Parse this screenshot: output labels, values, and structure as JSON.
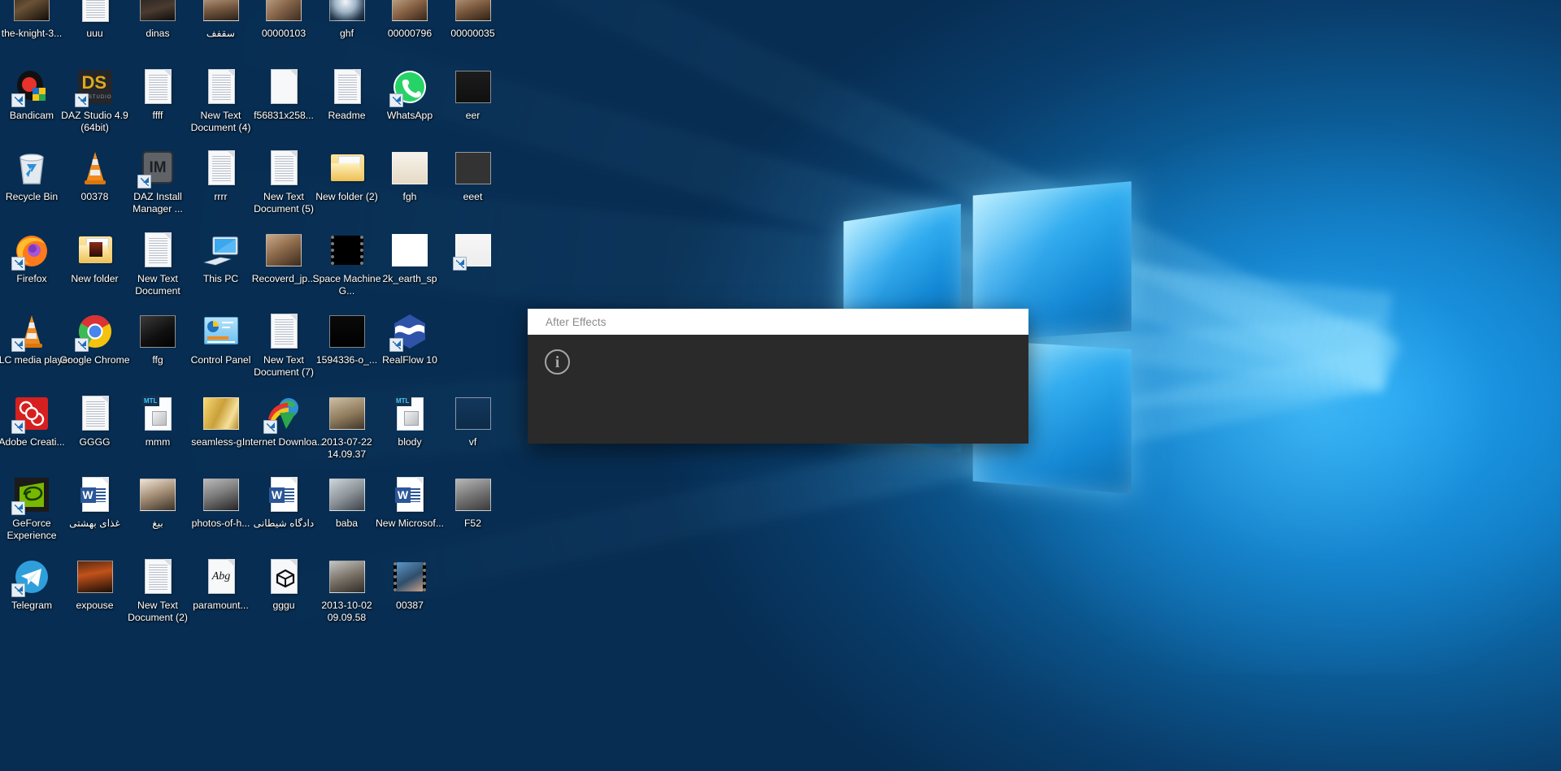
{
  "desktop": {
    "wallpaper_name": "windows-10-hero-blue",
    "colors": {
      "wallpaper_dark": "#0a2742",
      "wallpaper_accent": "#1a9ff0",
      "label_text": "#ffffff"
    },
    "icons": [
      {
        "label": "the-knight-3...",
        "art": "thumb",
        "thumb": "dark-figure",
        "shortcut": false,
        "col": 0,
        "row": 0
      },
      {
        "label": "uuu",
        "art": "doc",
        "shortcut": false,
        "col": 1,
        "row": 0
      },
      {
        "label": "dinas",
        "art": "thumb",
        "thumb": "dark-photo",
        "shortcut": false,
        "col": 2,
        "row": 0
      },
      {
        "label": "سقفف",
        "art": "thumb",
        "thumb": "man-portrait",
        "shortcut": false,
        "col": 3,
        "row": 0
      },
      {
        "label": "00000103",
        "art": "thumb",
        "thumb": "people-photo",
        "shortcut": false,
        "col": 4,
        "row": 0
      },
      {
        "label": "ghf",
        "art": "thumb",
        "thumb": "eye-sphere",
        "shortcut": false,
        "col": 5,
        "row": 0
      },
      {
        "label": "00000796",
        "art": "thumb",
        "thumb": "portrait-photo",
        "shortcut": false,
        "col": 6,
        "row": 0
      },
      {
        "label": "00000035",
        "art": "thumb",
        "thumb": "portrait-photo-2",
        "shortcut": false,
        "col": 7,
        "row": 0
      },
      {
        "label": "Bandicam",
        "art": "bandicam",
        "shortcut": true,
        "col": 0,
        "row": 1
      },
      {
        "label": "DAZ Studio 4.9 (64bit)",
        "art": "daz-studio",
        "shortcut": true,
        "col": 1,
        "row": 1
      },
      {
        "label": "ffff",
        "art": "doc",
        "shortcut": false,
        "col": 2,
        "row": 1
      },
      {
        "label": "New Text Document (4)",
        "art": "doc",
        "shortcut": false,
        "col": 3,
        "row": 1
      },
      {
        "label": "f56831x258...",
        "art": "doc-blank",
        "shortcut": false,
        "col": 4,
        "row": 1
      },
      {
        "label": "Readme",
        "art": "doc",
        "shortcut": false,
        "col": 5,
        "row": 1
      },
      {
        "label": "WhatsApp",
        "art": "whatsapp",
        "shortcut": true,
        "col": 6,
        "row": 1
      },
      {
        "label": "eer",
        "art": "thumb",
        "thumb": "negah-banner",
        "shortcut": false,
        "col": 7,
        "row": 1
      },
      {
        "label": "Recycle Bin",
        "art": "recycle-bin",
        "shortcut": false,
        "col": 0,
        "row": 2
      },
      {
        "label": "00378",
        "art": "vlc-cone",
        "shortcut": false,
        "col": 1,
        "row": 2
      },
      {
        "label": "DAZ Install Manager ...",
        "art": "daz-install-manager",
        "shortcut": true,
        "col": 2,
        "row": 2
      },
      {
        "label": "rrrr",
        "art": "doc",
        "shortcut": false,
        "col": 3,
        "row": 2
      },
      {
        "label": "New Text Document (5)",
        "art": "doc",
        "shortcut": false,
        "col": 4,
        "row": 2
      },
      {
        "label": "New folder (2)",
        "art": "folder",
        "shortcut": false,
        "col": 5,
        "row": 2
      },
      {
        "label": "fgh",
        "art": "thumb",
        "thumb": "pink-ribbon-badge",
        "shortcut": false,
        "col": 6,
        "row": 2
      },
      {
        "label": "eeet",
        "art": "thumb",
        "thumb": "negah-no-banner",
        "shortcut": false,
        "col": 7,
        "row": 2
      },
      {
        "label": "Firefox",
        "art": "firefox",
        "shortcut": true,
        "col": 0,
        "row": 3
      },
      {
        "label": "New folder",
        "art": "folder-media",
        "shortcut": false,
        "col": 1,
        "row": 3
      },
      {
        "label": "New Text Document",
        "art": "doc",
        "shortcut": false,
        "col": 2,
        "row": 3
      },
      {
        "label": "This PC",
        "art": "this-pc",
        "shortcut": false,
        "col": 3,
        "row": 3
      },
      {
        "label": "Recoverd_jp...",
        "art": "thumb",
        "thumb": "woman-interior",
        "shortcut": false,
        "col": 4,
        "row": 3
      },
      {
        "label": "Space Machine G...",
        "art": "film",
        "shortcut": false,
        "col": 5,
        "row": 3
      },
      {
        "label": "2k_earth_sp",
        "art": "thumb",
        "thumb": "earth-map-bw",
        "shortcut": false,
        "col": 6,
        "row": 3
      },
      {
        "label": "",
        "art": "thumb",
        "thumb": "red-arabic-poster",
        "shortcut": true,
        "col": 7,
        "row": 3
      },
      {
        "label": "VLC media player",
        "art": "vlc-cone",
        "shortcut": true,
        "col": 0,
        "row": 4
      },
      {
        "label": "Google Chrome",
        "art": "chrome",
        "shortcut": true,
        "col": 1,
        "row": 4
      },
      {
        "label": "ffg",
        "art": "thumb",
        "thumb": "man-black-bg",
        "shortcut": false,
        "col": 2,
        "row": 4
      },
      {
        "label": "Control Panel",
        "art": "control-panel",
        "shortcut": false,
        "col": 3,
        "row": 4
      },
      {
        "label": "New Text Document (7)",
        "art": "doc",
        "shortcut": false,
        "col": 4,
        "row": 4
      },
      {
        "label": "1594336-o_...",
        "art": "thumb",
        "thumb": "spaceship-bw",
        "shortcut": false,
        "col": 5,
        "row": 4
      },
      {
        "label": "RealFlow 10",
        "art": "realflow",
        "shortcut": true,
        "col": 6,
        "row": 4
      },
      {
        "label": "Adobe Creati...",
        "art": "adobe-cc",
        "shortcut": true,
        "col": 0,
        "row": 5
      },
      {
        "label": "GGGG",
        "art": "doc",
        "shortcut": false,
        "col": 1,
        "row": 5
      },
      {
        "label": "mmm",
        "art": "mtl",
        "shortcut": false,
        "col": 2,
        "row": 5
      },
      {
        "label": "seamless-g...",
        "art": "thumb",
        "thumb": "gold-gradient",
        "shortcut": false,
        "col": 3,
        "row": 5
      },
      {
        "label": "Internet Downloa...",
        "art": "idm",
        "shortcut": true,
        "col": 4,
        "row": 5
      },
      {
        "label": "2013-07-22 14.09.37",
        "art": "thumb",
        "thumb": "sepia-woman",
        "shortcut": false,
        "col": 5,
        "row": 5
      },
      {
        "label": "blody",
        "art": "mtl",
        "shortcut": false,
        "col": 6,
        "row": 5
      },
      {
        "label": "vf",
        "art": "thumb",
        "thumb": "faint-arabic-banner",
        "shortcut": false,
        "col": 7,
        "row": 5
      },
      {
        "label": "GeForce Experience",
        "art": "geforce",
        "shortcut": true,
        "col": 0,
        "row": 6
      },
      {
        "label": "غذای بهشتی",
        "art": "word",
        "shortcut": false,
        "col": 1,
        "row": 6
      },
      {
        "label": "بیغ",
        "art": "thumb",
        "thumb": "woman-hijab",
        "shortcut": false,
        "col": 2,
        "row": 6
      },
      {
        "label": "photos-of-h...",
        "art": "thumb",
        "thumb": "short-hair-woman",
        "shortcut": false,
        "col": 3,
        "row": 6
      },
      {
        "label": "دادگاه شیطانی",
        "art": "word",
        "shortcut": false,
        "col": 4,
        "row": 6
      },
      {
        "label": "baba",
        "art": "thumb",
        "thumb": "group-photo",
        "shortcut": false,
        "col": 5,
        "row": 6
      },
      {
        "label": "New Microsof...",
        "art": "word",
        "shortcut": false,
        "col": 6,
        "row": 6
      },
      {
        "label": "F52",
        "art": "thumb",
        "thumb": "grey-device",
        "shortcut": false,
        "col": 7,
        "row": 6
      },
      {
        "label": "Telegram",
        "art": "telegram",
        "shortcut": true,
        "col": 0,
        "row": 7
      },
      {
        "label": "expouse",
        "art": "thumb",
        "thumb": "fire-figures",
        "shortcut": false,
        "col": 1,
        "row": 7
      },
      {
        "label": "New Text Document (2)",
        "art": "doc",
        "shortcut": false,
        "col": 2,
        "row": 7
      },
      {
        "label": "paramount...",
        "art": "doc-abc",
        "shortcut": false,
        "col": 3,
        "row": 7
      },
      {
        "label": "gggu",
        "art": "doc-cube",
        "shortcut": false,
        "col": 4,
        "row": 7
      },
      {
        "label": "2013-10-02 09.09.58",
        "art": "thumb",
        "thumb": "older-woman",
        "shortcut": false,
        "col": 5,
        "row": 7
      },
      {
        "label": "00387",
        "art": "film-hand",
        "shortcut": false,
        "col": 6,
        "row": 7
      }
    ]
  },
  "dialog": {
    "name": "after-effects-alert",
    "title": "After Effects",
    "icon": "info-icon",
    "icon_glyph": "i",
    "message": "",
    "colors": {
      "titlebar_bg": "#ffffff",
      "title_text": "#8a8a8a",
      "body_bg": "#2a2a2a",
      "icon_stroke": "#a5a5a5"
    }
  }
}
